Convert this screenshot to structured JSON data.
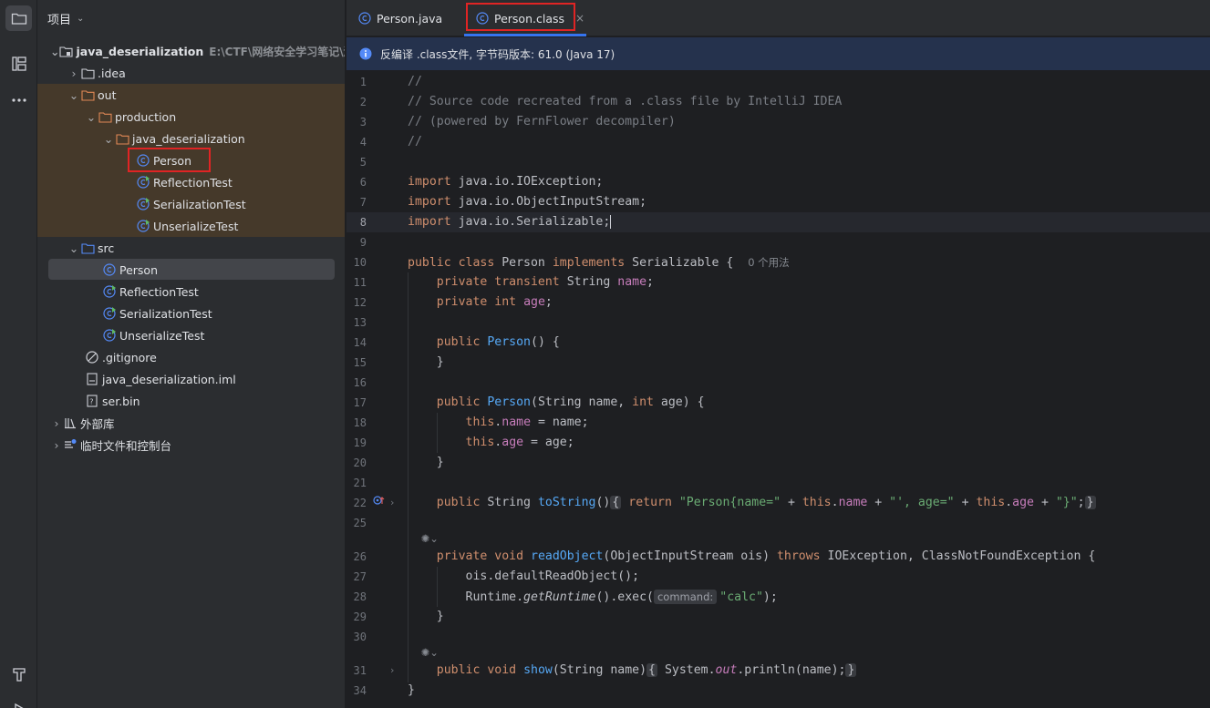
{
  "project": {
    "title": "项目",
    "tree": [
      {
        "label": "java_deserialization",
        "path": "E:\\CTF\\网络安全学习笔记\\漏洞",
        "icon": "module-folder-icon"
      },
      {
        "label": ".idea",
        "icon": "folder-icon"
      },
      {
        "label": "out",
        "icon": "folder-icon-orange"
      },
      {
        "label": "production",
        "icon": "folder-icon-orange"
      },
      {
        "label": "java_deserialization",
        "icon": "folder-icon-orange"
      },
      {
        "label": "Person",
        "icon": "class-icon"
      },
      {
        "label": "ReflectionTest",
        "icon": "runnable-class-icon"
      },
      {
        "label": "SerializationTest",
        "icon": "runnable-class-icon"
      },
      {
        "label": "UnserializeTest",
        "icon": "runnable-class-icon"
      },
      {
        "label": "src",
        "icon": "source-folder-icon"
      },
      {
        "label": "Person",
        "icon": "class-icon"
      },
      {
        "label": "ReflectionTest",
        "icon": "runnable-class-icon"
      },
      {
        "label": "SerializationTest",
        "icon": "runnable-class-icon"
      },
      {
        "label": "UnserializeTest",
        "icon": "runnable-class-icon"
      },
      {
        "label": ".gitignore",
        "icon": "ignore-file-icon"
      },
      {
        "label": "java_deserialization.iml",
        "icon": "iml-file-icon"
      },
      {
        "label": "ser.bin",
        "icon": "unknown-file-icon"
      },
      {
        "label": "外部库",
        "icon": "library-icon"
      },
      {
        "label": "临时文件和控制台",
        "icon": "scratches-icon"
      }
    ]
  },
  "tabs": [
    {
      "label": "Person.java"
    },
    {
      "label": "Person.class",
      "active": true
    }
  ],
  "banner": {
    "text": "反编译 .class文件, 字节码版本: 61.0 (Java 17)"
  },
  "editor": {
    "line_numbers": [
      "1",
      "2",
      "3",
      "4",
      "5",
      "6",
      "7",
      "8",
      "9",
      "10",
      "11",
      "12",
      "13",
      "14",
      "15",
      "16",
      "17",
      "18",
      "19",
      "20",
      "21",
      "22",
      "25",
      "26",
      "27",
      "28",
      "29",
      "30",
      "31",
      "34"
    ],
    "current_line": "8",
    "usage_hint": "0 个用法",
    "param_hint": "command:"
  },
  "colors": {
    "accent": "#3574f0",
    "highlight_box": "#e02424",
    "out_folder_bg": "#45392a"
  }
}
